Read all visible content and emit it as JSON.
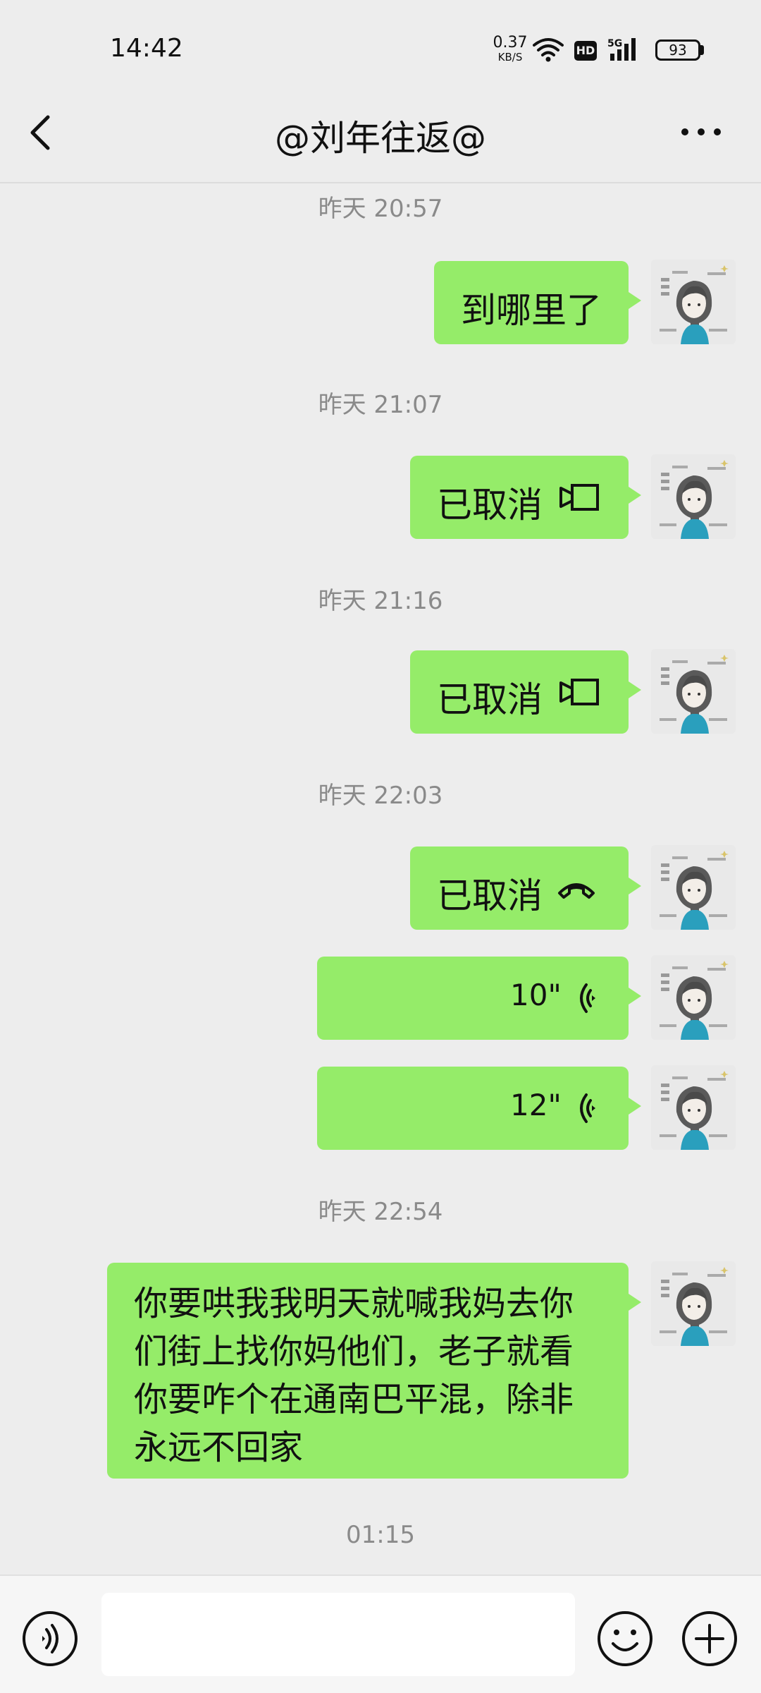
{
  "status_bar": {
    "time": "14:42",
    "net_speed_value": "0.37",
    "net_speed_unit": "KB/S",
    "hd": "HD",
    "network": "5G",
    "battery": "93"
  },
  "header": {
    "title": "@刘年往返@"
  },
  "timestamps": [
    "昨天 20:57",
    "昨天 21:07",
    "昨天 21:16",
    "昨天 22:03",
    "昨天 22:54",
    "01:15"
  ],
  "messages": [
    {
      "type": "text",
      "text": "到哪里了"
    },
    {
      "type": "video_call",
      "text": "已取消"
    },
    {
      "type": "video_call",
      "text": "已取消"
    },
    {
      "type": "voice_call",
      "text": "已取消"
    },
    {
      "type": "voice",
      "duration": "10\""
    },
    {
      "type": "voice",
      "duration": "12\""
    },
    {
      "type": "text",
      "text": "你要哄我我明天就喊我妈去你们街上找你妈他们，老子就看你要咋个在通南巴平混，除非永远不回家"
    }
  ],
  "input_bar": {
    "placeholder": ""
  },
  "colors": {
    "background": "#ededed",
    "bubble_green": "#95ec69",
    "timestamp_gray": "#8a8a8a"
  }
}
